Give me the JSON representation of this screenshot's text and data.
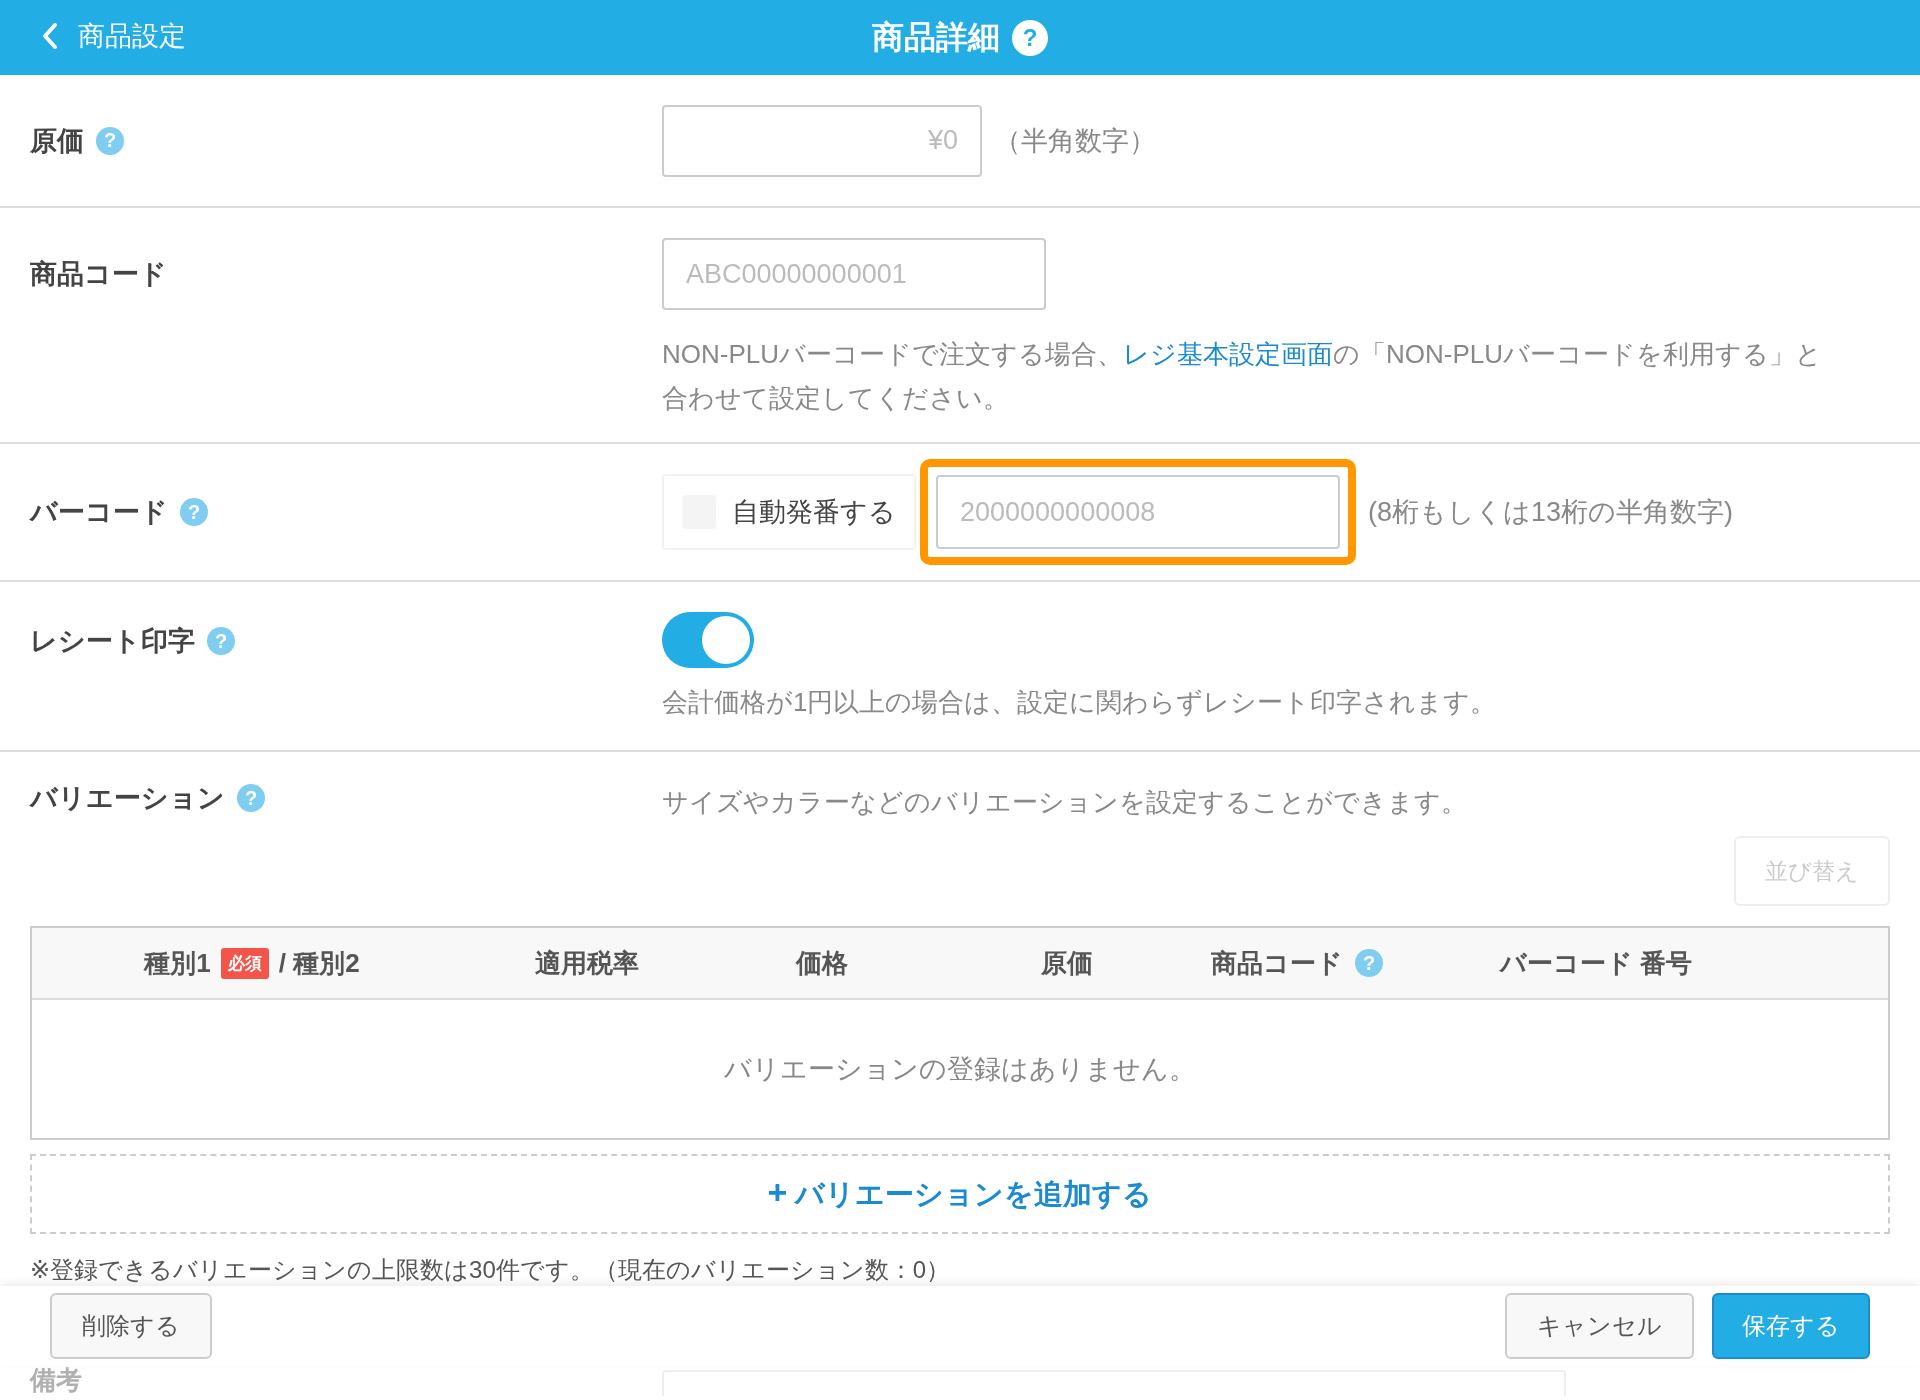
{
  "header": {
    "back_label": "商品設定",
    "title": "商品詳細",
    "help": "?"
  },
  "cost": {
    "label": "原価",
    "help": "?",
    "placeholder": "¥0",
    "hint": "（半角数字）"
  },
  "product_code": {
    "label": "商品コード",
    "placeholder": "ABC00000000001",
    "note_before": "NON-PLUバーコードで注文する場合、",
    "note_link": "レジ基本設定画面",
    "note_after": "の「NON-PLUバーコードを利用する」と合わせて設定してください。"
  },
  "barcode": {
    "label": "バーコード",
    "help": "?",
    "auto_label": "自動発番する",
    "auto_checked": false,
    "placeholder": "2000000000008",
    "highlighted": true,
    "hint": "(8桁もしくは13桁の半角数字)"
  },
  "receipt": {
    "label": "レシート印字",
    "help": "?",
    "on": true,
    "note": "会計価格が1円以上の場合は、設定に関わらずレシート印字されます。"
  },
  "variations": {
    "label": "バリエーション",
    "help": "?",
    "description": "サイズやカラーなどのバリエーションを設定することができます。",
    "sort_button": "並び替え",
    "sort_disabled": true,
    "columns": [
      {
        "label": "種別1",
        "badge": "必須",
        "label_2": "/ 種別2"
      },
      {
        "label": "適用税率"
      },
      {
        "label": "価格"
      },
      {
        "label": "原価"
      },
      {
        "label": "商品コード",
        "help": "?"
      },
      {
        "label": "バーコード 番号"
      }
    ],
    "empty_message": "バリエーションの登録はありません。",
    "add_icon": "+",
    "add_label": "バリエーションを追加する",
    "limit_note": "※登録できるバリエーションの上限数は30件です。（現在のバリエーション数：0）"
  },
  "notes": {
    "label": "備考"
  },
  "footer": {
    "delete": "削除する",
    "cancel": "キャンセル",
    "save": "保存する"
  }
}
